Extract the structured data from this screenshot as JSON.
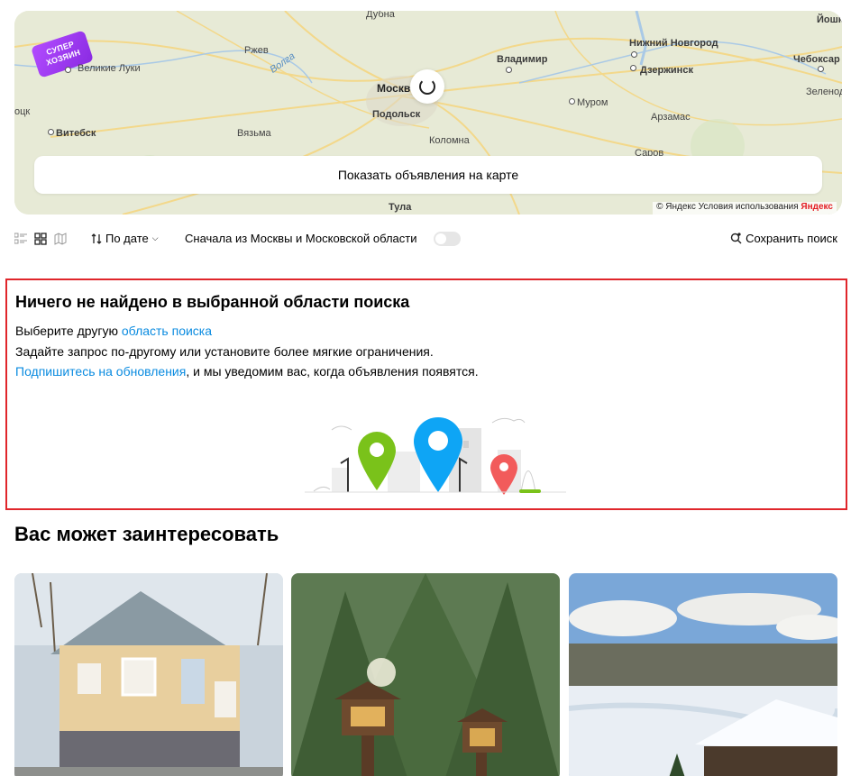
{
  "map": {
    "badge": "СУПЕР ХОЗЯИН",
    "cities": [
      {
        "name": "Дубна",
        "kind": "light"
      },
      {
        "name": "Великие Луки",
        "kind": "light"
      },
      {
        "name": "Ржев",
        "kind": "light"
      },
      {
        "name": "Волга",
        "kind": "river"
      },
      {
        "name": "Владимир",
        "kind": "bold"
      },
      {
        "name": "Нижний Новгород",
        "kind": "bold"
      },
      {
        "name": "Йошк",
        "kind": "bold"
      },
      {
        "name": "Дзержинск",
        "kind": "bold"
      },
      {
        "name": "Чебоксар",
        "kind": "bold"
      },
      {
        "name": "Москв",
        "kind": "big"
      },
      {
        "name": "Подольск",
        "kind": "bold"
      },
      {
        "name": "Муром",
        "kind": "light"
      },
      {
        "name": "Зеленод",
        "kind": "light"
      },
      {
        "name": "Витебск",
        "kind": "bold"
      },
      {
        "name": "Вязьма",
        "kind": "light"
      },
      {
        "name": "Коломна",
        "kind": "light"
      },
      {
        "name": "Арзамас",
        "kind": "light"
      },
      {
        "name": "Саров",
        "kind": "light"
      },
      {
        "name": "Тула",
        "kind": "bold"
      },
      {
        "name": "оцк",
        "kind": "light"
      }
    ],
    "show_button": "Показать объявления на карте",
    "attribution": "© Яндекс Условия использования",
    "attribution_logo": "Яндекс"
  },
  "toolbar": {
    "view_icons": [
      "list-view-icon",
      "grid-view-icon",
      "map-view-icon"
    ],
    "sort_label": "По дате",
    "moscow_first_label": "Сначала из Москвы и Московской области",
    "moscow_first_on": false,
    "save_search_label": "Сохранить поиск"
  },
  "empty_state": {
    "title": "Ничего не найдено в выбранной области поиска",
    "line1_text": "Выберите другую ",
    "line1_link": "область поиска",
    "line2_text": "Задайте запрос по-другому или установите более мягкие ограничения.",
    "line3_link": "Подпишитесь на обновления",
    "line3_text": ", и мы уведомим вас, когда объявления появятся."
  },
  "recommendations": {
    "title": "Вас может заинтересовать",
    "cards": [
      {
        "image": "house-photo"
      },
      {
        "image": "garden-lanterns-photo"
      },
      {
        "image": "winter-lake-cabin-photo"
      }
    ]
  },
  "colors": {
    "link": "#0a8be0",
    "highlight_border": "#e0262b",
    "pin_blue": "#0ea5f5",
    "pin_green": "#7ac21a",
    "pin_red": "#f25b5b"
  }
}
